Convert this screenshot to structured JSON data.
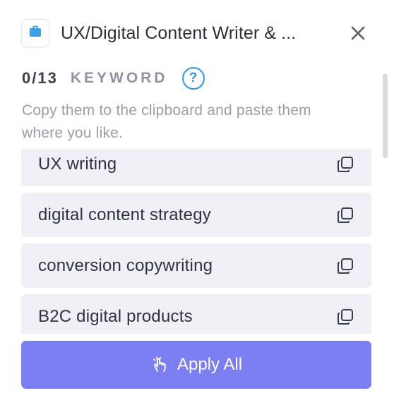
{
  "header": {
    "title": "UX/Digital Content Writer & ...",
    "app_icon": "briefcase-icon",
    "close_icon": "close-icon"
  },
  "keywords_section": {
    "count": "0/13",
    "label": "KEYWORD",
    "help_symbol": "?",
    "description": "Copy them to the clipboard and paste them where you like."
  },
  "keywords": [
    {
      "text": "UX writing",
      "icon": "copy-icon"
    },
    {
      "text": "digital content strategy",
      "icon": "copy-icon"
    },
    {
      "text": "conversion copywriting",
      "icon": "copy-icon"
    },
    {
      "text": "B2C digital products",
      "icon": "copy-icon"
    }
  ],
  "apply_button": {
    "label": "Apply All",
    "icon": "hand-pointer-icon"
  },
  "colors": {
    "accent": "#7c7ff2",
    "help": "#2f97e8",
    "item_bg": "#eef0f6",
    "app_icon": "#3aa0e6"
  }
}
